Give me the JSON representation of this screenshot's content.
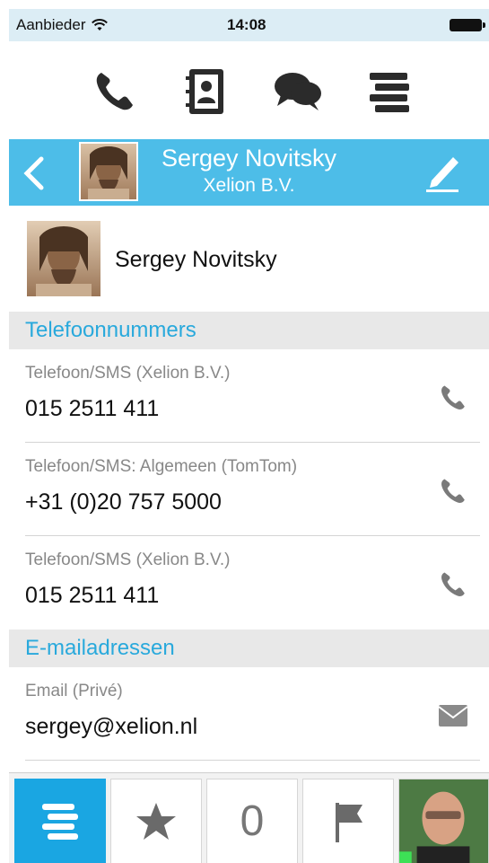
{
  "status_bar": {
    "carrier": "Aanbieder",
    "time": "14:08"
  },
  "top_nav": {
    "items": [
      "phone-icon",
      "contacts-icon",
      "chat-icon",
      "list-icon"
    ]
  },
  "header": {
    "name": "Sergey Novitsky",
    "company": "Xelion B.V."
  },
  "contact": {
    "name": "Sergey Novitsky"
  },
  "phones": {
    "title": "Telefoonnummers",
    "items": [
      {
        "label": "Telefoon/SMS (Xelion B.V.)",
        "value": "015 2511 411"
      },
      {
        "label": "Telefoon/SMS: Algemeen (TomTom)",
        "value": "+31 (0)20 757 5000"
      },
      {
        "label": "Telefoon/SMS (Xelion B.V.)",
        "value": "015 2511 411"
      }
    ]
  },
  "emails": {
    "title": "E-mailadressen",
    "items": [
      {
        "label": "Email (Privé)",
        "value": "sergey@xelion.nl"
      }
    ]
  },
  "tab_bar": {
    "missed_count": "0"
  },
  "colors": {
    "accent": "#4dbde8",
    "active_tab": "#1aa6e2",
    "section_text": "#29a9dc"
  }
}
